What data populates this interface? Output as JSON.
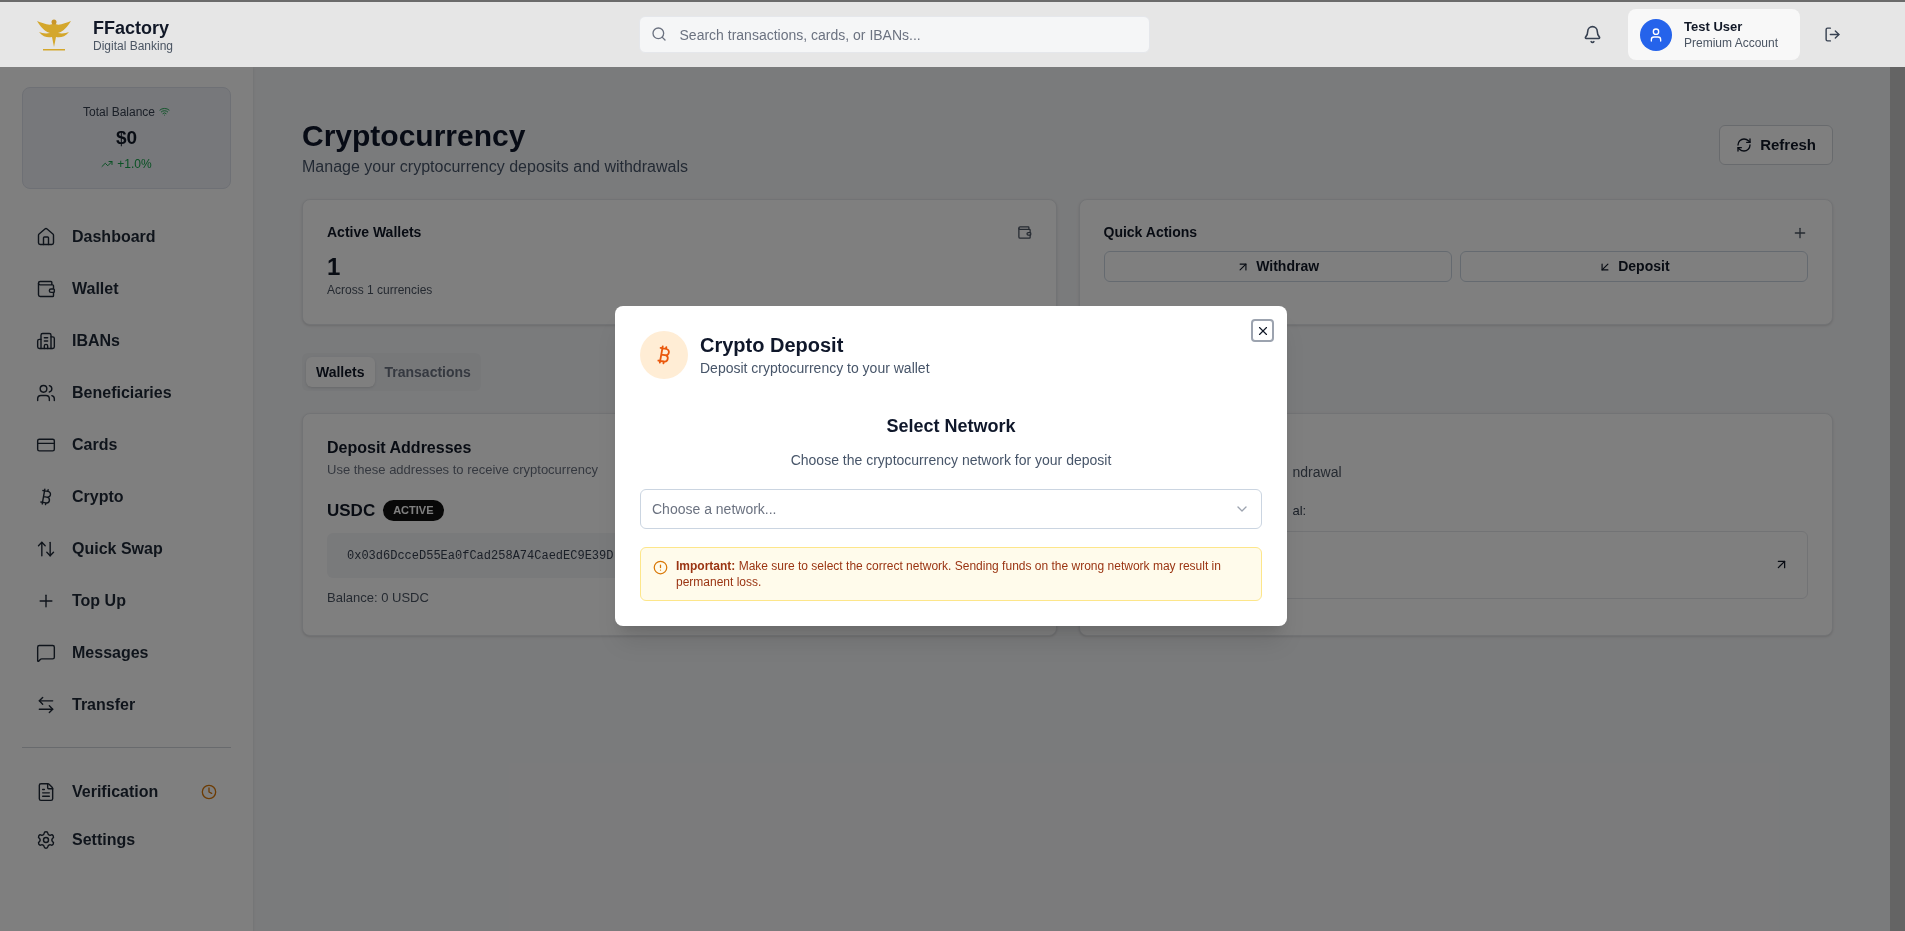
{
  "header": {
    "brand": "FFactory",
    "tagline": "Digital Banking",
    "search": {
      "placeholder": "Search transactions, cards, or IBANs..."
    },
    "user": {
      "name": "Test User",
      "plan": "Premium Account"
    }
  },
  "sidebar": {
    "balance": {
      "label": "Total Balance",
      "amount": "$0",
      "change": "+1.0%"
    },
    "nav": [
      {
        "label": "Dashboard"
      },
      {
        "label": "Wallet"
      },
      {
        "label": "IBANs"
      },
      {
        "label": "Beneficiaries"
      },
      {
        "label": "Cards"
      },
      {
        "label": "Crypto"
      },
      {
        "label": "Quick Swap"
      },
      {
        "label": "Top Up"
      },
      {
        "label": "Messages"
      },
      {
        "label": "Transfer"
      }
    ],
    "bottom_nav": [
      {
        "label": "Verification",
        "pending": true
      },
      {
        "label": "Settings",
        "pending": false
      }
    ]
  },
  "page": {
    "title": "Cryptocurrency",
    "subtitle": "Manage your cryptocurrency deposits and withdrawals",
    "refresh_button": "Refresh"
  },
  "active_wallets": {
    "title": "Active Wallets",
    "value": "1",
    "note": "Across 1 currencies"
  },
  "quick_actions": {
    "title": "Quick Actions",
    "buttons": [
      {
        "label": "Withdraw",
        "kind": "withdraw"
      },
      {
        "label": "Deposit",
        "kind": "deposit"
      }
    ]
  },
  "tabs": [
    {
      "label": "Wallets",
      "selected": true
    },
    {
      "label": "Transactions",
      "selected": false
    }
  ],
  "deposit_card": {
    "title": "Deposit Addresses",
    "description": "Use these addresses to receive cryptocurrency",
    "currency": "USDC",
    "status": "ACTIVE",
    "address": "0x03d6DcceD55Ea0fCad258A74CaedEC9E39D",
    "balance": "Balance: 0 USDC"
  },
  "withdraw_card": {
    "description": "ndrawal",
    "field_label": "al:"
  },
  "modal": {
    "title": "Crypto Deposit",
    "subtitle": "Deposit cryptocurrency to your wallet",
    "heading": "Select Network",
    "prompt": "Choose the cryptocurrency network for your deposit",
    "select": {
      "placeholder": "Choose a network..."
    },
    "warning": "**Important:** Make sure to select the correct network. Sending funds on the wrong network may result in permanent loss."
  }
}
